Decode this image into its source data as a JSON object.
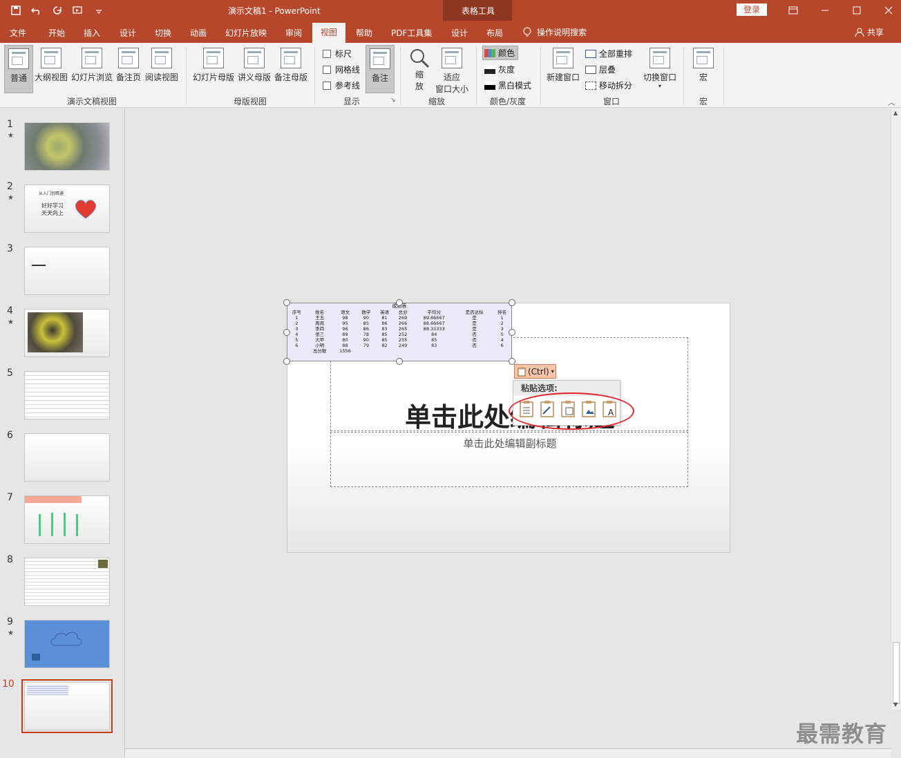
{
  "titlebar": {
    "title": "演示文稿1  -  PowerPoint",
    "context_tools": "表格工具",
    "login": "登录"
  },
  "tabs": {
    "items": [
      "文件",
      "开始",
      "插入",
      "设计",
      "切换",
      "动画",
      "幻灯片放映",
      "审阅",
      "视图",
      "帮助",
      "PDF工具集",
      "设计",
      "布局"
    ],
    "active": "视图",
    "tellme": "操作说明搜索",
    "share": "共享"
  },
  "ribbon": {
    "presentation_views": {
      "label": "演示文稿视图",
      "buttons": [
        "普通",
        "大纲视图",
        "幻灯片浏览",
        "备注页",
        "阅读视图"
      ]
    },
    "master_views": {
      "label": "母版视图",
      "buttons": [
        "幻灯片母版",
        "讲义母版",
        "备注母版"
      ]
    },
    "show": {
      "label": "显示",
      "checks": [
        "标尺",
        "网格线",
        "参考线"
      ],
      "notes": "备注"
    },
    "zoom": {
      "label": "缩放",
      "zoom_top": "缩",
      "zoom_bottom": "放",
      "fit_top": "适应",
      "fit_bottom": "窗口大小"
    },
    "color": {
      "label": "颜色/灰度",
      "items": [
        "颜色",
        "灰度",
        "黑白模式"
      ]
    },
    "window": {
      "label": "窗口",
      "new_window": "新建窗口",
      "items": [
        "全部重排",
        "层叠",
        "移动拆分"
      ],
      "switch": "切换窗口"
    },
    "macro": {
      "label": "宏",
      "button": "宏"
    }
  },
  "thumbnails": {
    "numbers": [
      "1",
      "2",
      "3",
      "4",
      "5",
      "6",
      "7",
      "8",
      "9",
      "10"
    ],
    "star": "★",
    "slide2_line1": "从入门到精通",
    "slide2_line2": "好好学习",
    "slide2_line3": "天天向上"
  },
  "table": {
    "caption": "成绩表",
    "headers": [
      "序号",
      "姓名",
      "语文",
      "数学",
      "英语",
      "总分",
      "平均分",
      "是否达标",
      "排名"
    ],
    "rows": [
      [
        "1",
        "王五",
        "98",
        "90",
        "81",
        "269",
        "89.66667",
        "是",
        "1"
      ],
      [
        "2",
        "周周",
        "95",
        "85",
        "86",
        "266",
        "88.66667",
        "是",
        "2"
      ],
      [
        "3",
        "李四",
        "96",
        "86",
        "83",
        "265",
        "88.33333",
        "是",
        "3"
      ],
      [
        "4",
        "张三",
        "89",
        "78",
        "85",
        "252",
        "84",
        "否",
        "5"
      ],
      [
        "5",
        "大甲",
        "80",
        "90",
        "85",
        "255",
        "85",
        "否",
        "4"
      ],
      [
        "6",
        "小明",
        "88",
        "79",
        "82",
        "249",
        "83",
        "否",
        "6"
      ]
    ],
    "total_label": "总分数",
    "total_value": "1556"
  },
  "slide": {
    "title_placeholder": "单击此处编辑标题",
    "subtitle_placeholder": "单击此处编辑副标题"
  },
  "paste": {
    "tag": "(Ctrl)",
    "menu_title": "粘贴选项:"
  },
  "watermark": "最需教育"
}
